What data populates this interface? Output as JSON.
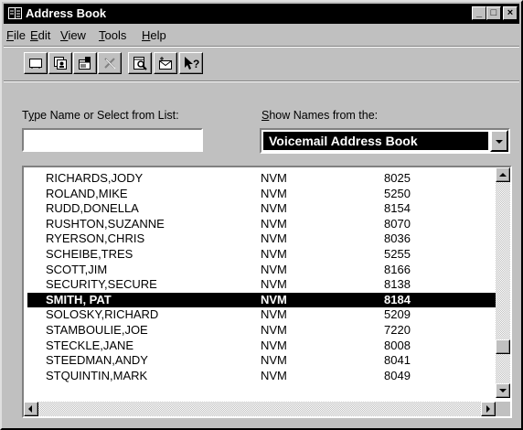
{
  "window": {
    "title": "Address Book",
    "controls": {
      "minimize": "_",
      "maximize": "□",
      "close": "×"
    }
  },
  "menu": [
    {
      "pre": "",
      "key": "F",
      "post": "ile"
    },
    {
      "pre": "",
      "key": "E",
      "post": "dit"
    },
    {
      "pre": "",
      "key": "V",
      "post": "iew"
    },
    {
      "pre": "",
      "key": "T",
      "post": "ools"
    },
    {
      "pre": "",
      "key": "H",
      "post": "elp"
    }
  ],
  "toolbar": {
    "icons": [
      "new-card-icon",
      "new-group-icon",
      "properties-icon",
      "delete-icon",
      "find-icon",
      "send-message-icon",
      "help-pointer-icon"
    ]
  },
  "search": {
    "label_pre": "T",
    "label_key": "y",
    "label_post": "pe Name or Select from List:",
    "value": ""
  },
  "source": {
    "label_pre": "",
    "label_key": "S",
    "label_post": "how Names from the:",
    "selected": "Voicemail Address Book"
  },
  "list": {
    "rows": [
      {
        "name": "RICHARDS,JODY",
        "type": "NVM",
        "number": "8025"
      },
      {
        "name": "ROLAND,MIKE",
        "type": "NVM",
        "number": "5250"
      },
      {
        "name": "RUDD,DONELLA",
        "type": "NVM",
        "number": "8154"
      },
      {
        "name": "RUSHTON,SUZANNE",
        "type": "NVM",
        "number": "8070"
      },
      {
        "name": "RYERSON,CHRIS",
        "type": "NVM",
        "number": "8036"
      },
      {
        "name": "SCHEIBE,TRES",
        "type": "NVM",
        "number": "5255"
      },
      {
        "name": "SCOTT,JIM",
        "type": "NVM",
        "number": "8166"
      },
      {
        "name": "SECURITY,SECURE",
        "type": "NVM",
        "number": "8138"
      },
      {
        "name": "SMITH, PAT",
        "type": "NVM",
        "number": "8184"
      },
      {
        "name": "SOLOSKY,RICHARD",
        "type": "NVM",
        "number": "5209"
      },
      {
        "name": "STAMBOULIE,JOE",
        "type": "NVM",
        "number": "7220"
      },
      {
        "name": "STECKLE,JANE",
        "type": "NVM",
        "number": "8008"
      },
      {
        "name": "STEEDMAN,ANDY",
        "type": "NVM",
        "number": "8041"
      },
      {
        "name": "STQUINTIN,MARK",
        "type": "NVM",
        "number": "8049"
      }
    ],
    "selected_index": 8
  },
  "colors": {
    "face": "#c0c0c0",
    "title_bg": "#000000",
    "selection_bg": "#000000",
    "selection_fg": "#ffffff"
  }
}
